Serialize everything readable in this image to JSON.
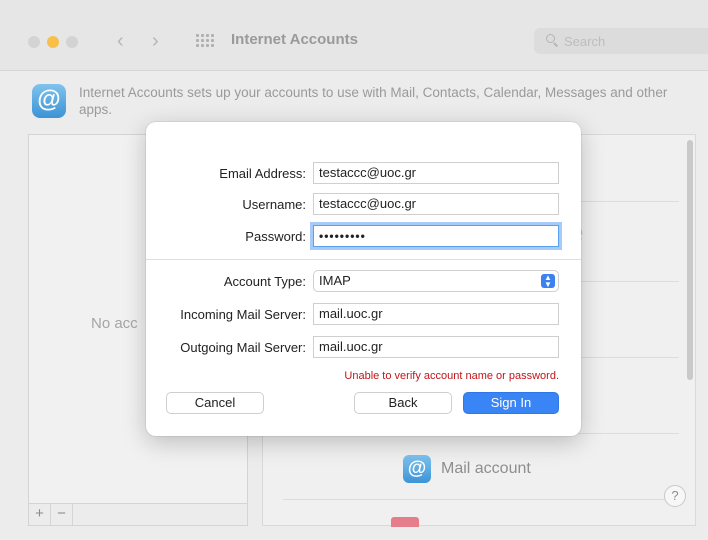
{
  "window": {
    "title": "Internet Accounts",
    "search_placeholder": "Search"
  },
  "intro": {
    "app_icon_glyph": "@",
    "text": "Internet Accounts sets up your accounts to use with Mail, Contacts, Calendar, Messages and other apps."
  },
  "account_list": {
    "empty_text": "No acc",
    "add_label": "+",
    "remove_label": "−"
  },
  "right_panel": {
    "faded_letter": "e",
    "mail_icon_glyph": "@",
    "mail_account_label": "Mail account",
    "help_label": "?"
  },
  "sheet": {
    "email_label": "Email Address:",
    "email_value": "testaccc@uoc.gr",
    "username_label": "Username:",
    "username_value": "testaccc@uoc.gr",
    "password_label": "Password:",
    "password_value": "•••••••••",
    "account_type_label": "Account Type:",
    "account_type_value": "IMAP",
    "incoming_label": "Incoming Mail Server:",
    "incoming_value": "mail.uoc.gr",
    "outgoing_label": "Outgoing Mail Server:",
    "outgoing_value": "mail.uoc.gr",
    "error_text": "Unable to verify account name or password.",
    "cancel_label": "Cancel",
    "back_label": "Back",
    "signin_label": "Sign In"
  },
  "colors": {
    "accent": "#3a85f5",
    "error": "#c2151a",
    "traffic_min": "#f7c04a"
  }
}
